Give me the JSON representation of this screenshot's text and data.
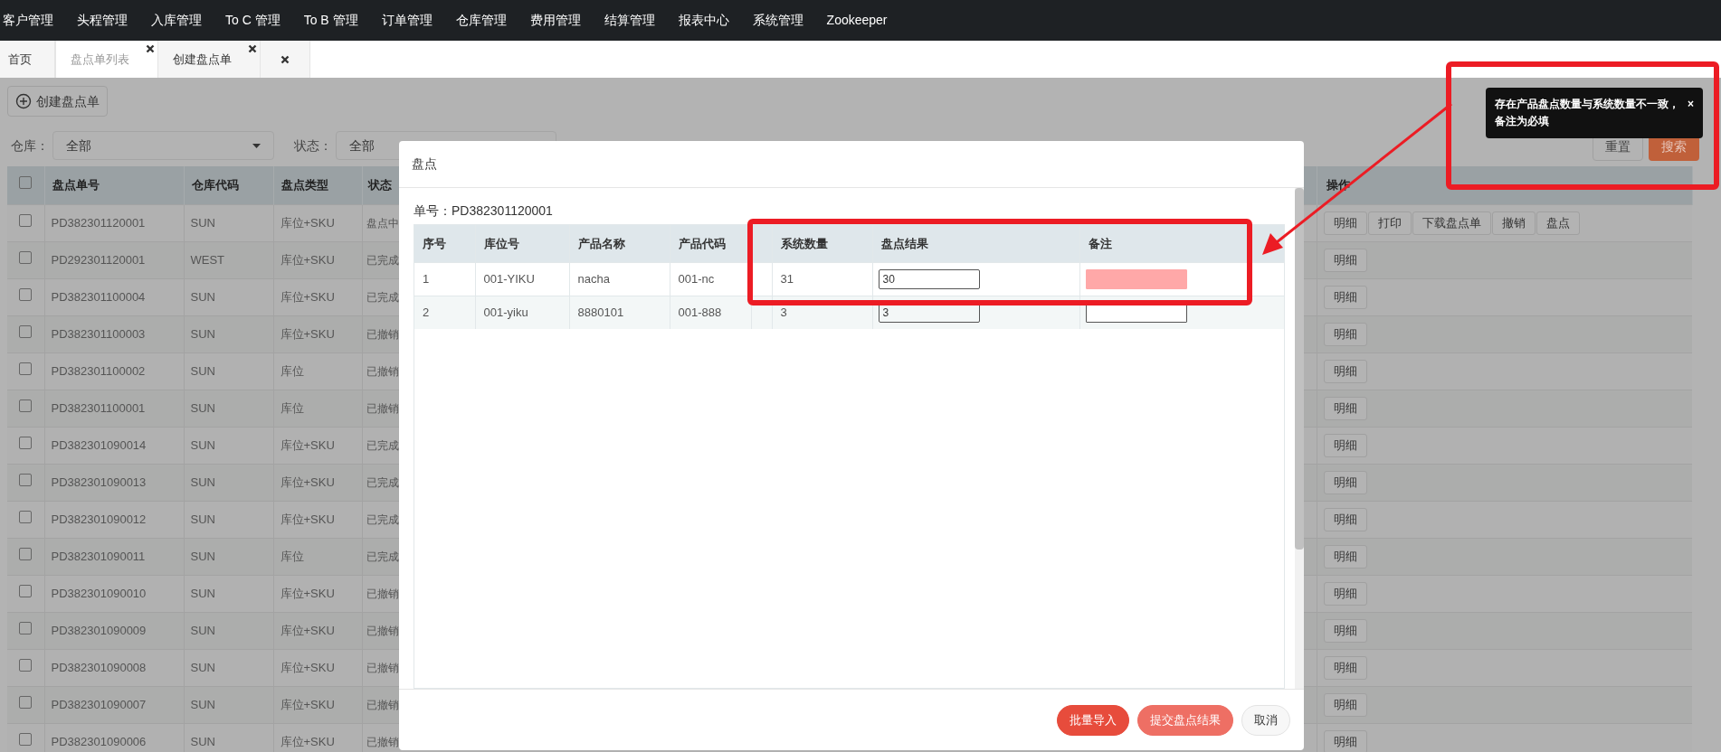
{
  "nav": {
    "items": [
      "客户管理",
      "头程管理",
      "入库管理",
      "To C 管理",
      "To B 管理",
      "订单管理",
      "仓库管理",
      "费用管理",
      "结算管理",
      "报表中心",
      "系统管理",
      "Zookeeper"
    ]
  },
  "tabs": [
    {
      "label": "首页",
      "selected": false,
      "closable": false
    },
    {
      "label": "盘点单列表",
      "selected": true,
      "closable": true
    },
    {
      "label": "创建盘点单",
      "selected": false,
      "closable": true
    },
    {
      "selected": false,
      "closable": true
    }
  ],
  "toolbar": {
    "create_button": "创建盘点单"
  },
  "filters": [
    {
      "label": "仓库：",
      "value": "全部"
    },
    {
      "label": "状态：",
      "value": "全部"
    }
  ],
  "search_buttons": [
    {
      "label": "重置",
      "kind": "default"
    },
    {
      "label": "搜索",
      "kind": "primary"
    }
  ],
  "table": {
    "select_all": {
      "checked": false
    },
    "columns": [
      "盘点单号",
      "仓库代码",
      "盘点类型",
      "状态",
      "操作"
    ],
    "rows": [
      {
        "checked": false,
        "cells": [
          "PD382301120001",
          "SUN",
          "库位+SKU",
          "盘点中"
        ],
        "actions": [
          "明细",
          "打印",
          "下载盘点单",
          "撤销",
          "盘点"
        ]
      },
      {
        "checked": false,
        "cells": [
          "PD292301120001",
          "WEST",
          "库位+SKU",
          "已完成"
        ],
        "actions": [
          "明细"
        ]
      },
      {
        "checked": false,
        "cells": [
          "PD382301100004",
          "SUN",
          "库位+SKU",
          "已完成"
        ],
        "actions": [
          "明细"
        ]
      },
      {
        "checked": false,
        "cells": [
          "PD382301100003",
          "SUN",
          "库位+SKU",
          "已撤销"
        ],
        "actions": [
          "明细"
        ]
      },
      {
        "checked": false,
        "cells": [
          "PD382301100002",
          "SUN",
          "库位",
          "已撤销"
        ],
        "actions": [
          "明细"
        ]
      },
      {
        "checked": false,
        "cells": [
          "PD382301100001",
          "SUN",
          "库位",
          "已撤销"
        ],
        "actions": [
          "明细"
        ]
      },
      {
        "checked": false,
        "cells": [
          "PD382301090014",
          "SUN",
          "库位+SKU",
          "已完成"
        ],
        "actions": [
          "明细"
        ]
      },
      {
        "checked": false,
        "cells": [
          "PD382301090013",
          "SUN",
          "库位+SKU",
          "已完成"
        ],
        "actions": [
          "明细"
        ]
      },
      {
        "checked": false,
        "cells": [
          "PD382301090012",
          "SUN",
          "库位+SKU",
          "已完成"
        ],
        "actions": [
          "明细"
        ]
      },
      {
        "checked": false,
        "cells": [
          "PD382301090011",
          "SUN",
          "库位",
          "已完成"
        ],
        "actions": [
          "明细"
        ]
      },
      {
        "checked": false,
        "cells": [
          "PD382301090010",
          "SUN",
          "库位+SKU",
          "已撤销"
        ],
        "actions": [
          "明细"
        ]
      },
      {
        "checked": false,
        "cells": [
          "PD382301090009",
          "SUN",
          "库位+SKU",
          "已撤销"
        ],
        "actions": [
          "明细"
        ]
      },
      {
        "checked": false,
        "cells": [
          "PD382301090008",
          "SUN",
          "库位+SKU",
          "已撤销"
        ],
        "actions": [
          "明细"
        ]
      },
      {
        "checked": false,
        "cells": [
          "PD382301090007",
          "SUN",
          "库位+SKU",
          "已撤销"
        ],
        "actions": [
          "明细"
        ]
      },
      {
        "checked": false,
        "cells": [
          "PD382301090006",
          "SUN",
          "库位+SKU",
          "已撤销"
        ],
        "actions": [
          "明细"
        ]
      }
    ]
  },
  "modal": {
    "title": "盘点",
    "order_label": "单号：PD382301120001",
    "table": {
      "columns": [
        "序号",
        "库位号",
        "产品名称",
        "产品代码",
        "系统数量",
        "盘点结果",
        "备注"
      ],
      "rows": [
        {
          "cells": [
            "1",
            "001-YIKU",
            "nacha",
            "001-nc",
            "31"
          ],
          "count": "30",
          "remark_error": true
        },
        {
          "cells": [
            "2",
            "001-yiku",
            "8880101",
            "001-888",
            "3"
          ],
          "count": "3",
          "remark_error": false
        }
      ]
    },
    "buttons": [
      {
        "label": "批量导入",
        "kind": "danger"
      },
      {
        "label": "提交盘点结果",
        "kind": "danger-light"
      },
      {
        "label": "取消",
        "kind": "default"
      }
    ]
  },
  "toast": {
    "message": "存在产品盘点数量与系统数量不一致，备注为必填",
    "close": "×"
  }
}
